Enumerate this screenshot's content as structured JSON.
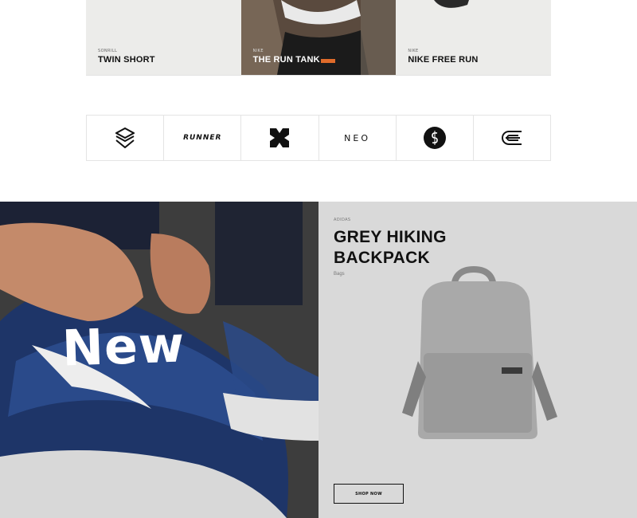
{
  "products": [
    {
      "brand": "SONRILL",
      "name": "TWIN SHORT"
    },
    {
      "brand": "NIKE",
      "name": "THE RUN TANK"
    },
    {
      "brand": "NIKE",
      "name": "NIKE FREE RUN"
    }
  ],
  "brand_logos": [
    {
      "icon": "s-shield-logo"
    },
    {
      "text": "RUNNER"
    },
    {
      "icon": "x-logo"
    },
    {
      "text": "NEO"
    },
    {
      "icon": "s-circle-logo"
    },
    {
      "icon": "e-logo"
    }
  ],
  "promo_left": {
    "label": "New"
  },
  "promo_right": {
    "brand": "ADIDAS",
    "title": "GREY HIKING BACKPACK",
    "category": "Bags",
    "cta": "SHOP NOW"
  }
}
